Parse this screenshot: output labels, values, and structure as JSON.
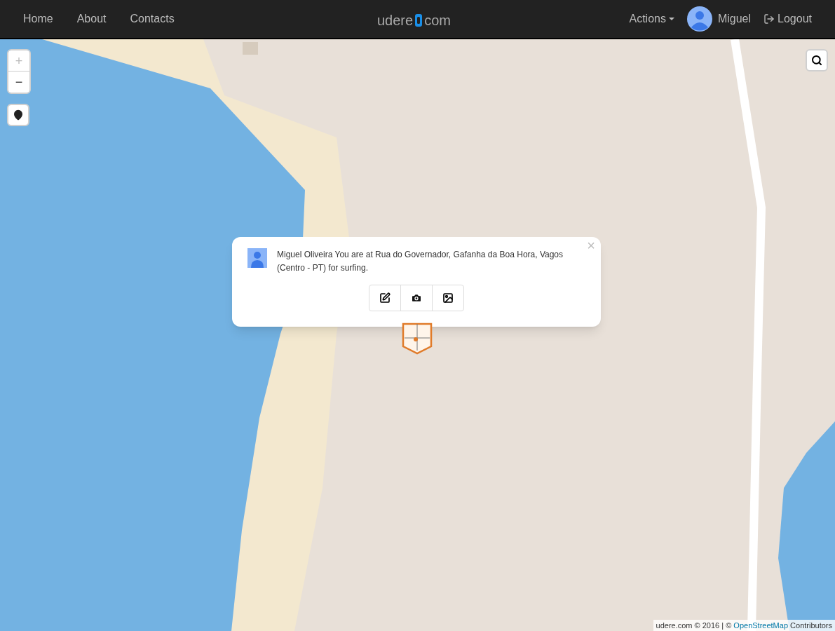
{
  "navbar": {
    "links": [
      "Home",
      "About",
      "Contacts"
    ],
    "logo": {
      "left": "udere",
      "right": "com"
    },
    "actions": "Actions",
    "user": "Miguel",
    "logout": "Logout"
  },
  "map_controls": {
    "zoom_in": {
      "label": "+",
      "disabled": true
    },
    "zoom_out": {
      "label": "−",
      "disabled": false
    }
  },
  "popup": {
    "message": "Miguel Oliveira You are at Rua do Governador, Gafanha da Boa Hora, Vagos (Centro - PT) for surfing.",
    "close": "×"
  },
  "attribution": {
    "prefix": "udere.com © 2016 | © ",
    "link": "OpenStreetMap",
    "suffix": " Contributors"
  }
}
